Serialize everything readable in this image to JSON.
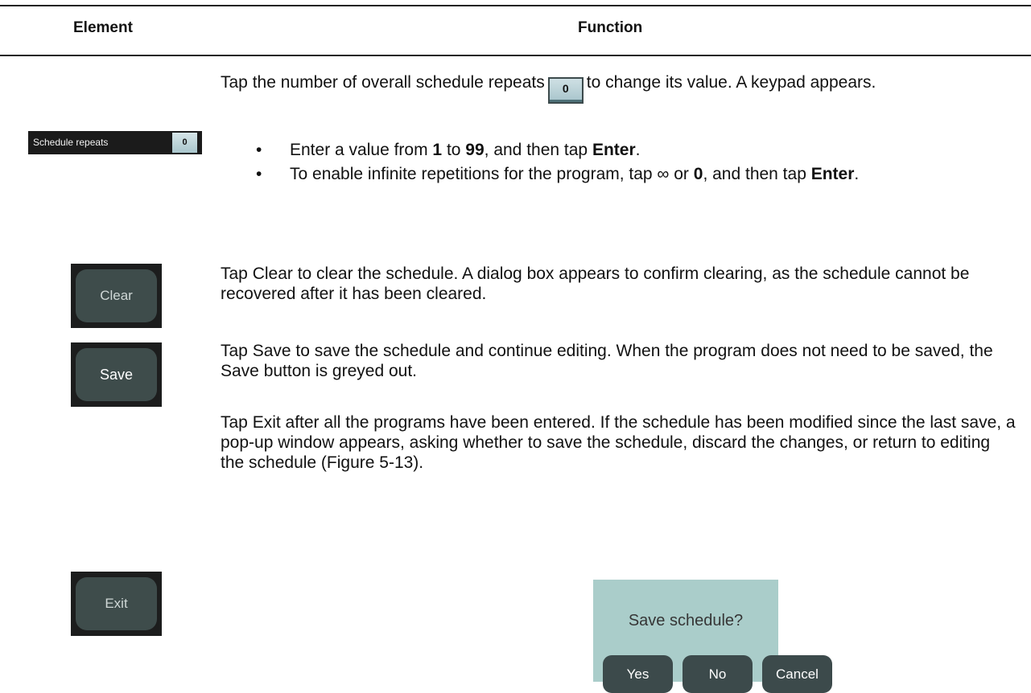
{
  "header": {
    "element": "Element",
    "function": "Function"
  },
  "rows": {
    "repeats": {
      "image_label": "Schedule repeats",
      "image_value": "0",
      "text_a": "Tap the number of overall schedule repeats",
      "badge": "0",
      "text_b": "to change its value. A keypad appears.",
      "bullet1": {
        "a": "Enter a value from ",
        "b1": "1",
        "c": " to ",
        "b2": "99",
        "d": ", and then tap ",
        "b3": "Enter",
        "e": "."
      },
      "bullet2": {
        "a": "To enable infinite repetitions for the program, tap ∞ or ",
        "b1": "0",
        "c": ", and then tap ",
        "b2": "Enter",
        "d": "."
      }
    },
    "clear": {
      "button": "Clear",
      "text": "Tap Clear to clear the schedule. A dialog box appears to confirm clearing, as the schedule cannot be recovered after it has been cleared."
    },
    "save": {
      "button": "Save",
      "text": "Tap Save to save the schedule and continue editing. When the program does not need to be saved, the Save button is greyed out."
    },
    "exit": {
      "button": "Exit",
      "text": "Tap Exit after all the programs have been entered. If the schedule has been modified since the last save, a pop-up window appears, asking whether to save the schedule, discard the changes, or return to editing the schedule (Figure 5-13).",
      "dialog": {
        "question": "Save schedule?",
        "yes": "Yes",
        "no": "No",
        "cancel": "Cancel"
      }
    }
  },
  "colors": {
    "button_face": "#3e4c4b",
    "dialog_background": "#aacdca",
    "value_box": "#a9c6cc"
  }
}
